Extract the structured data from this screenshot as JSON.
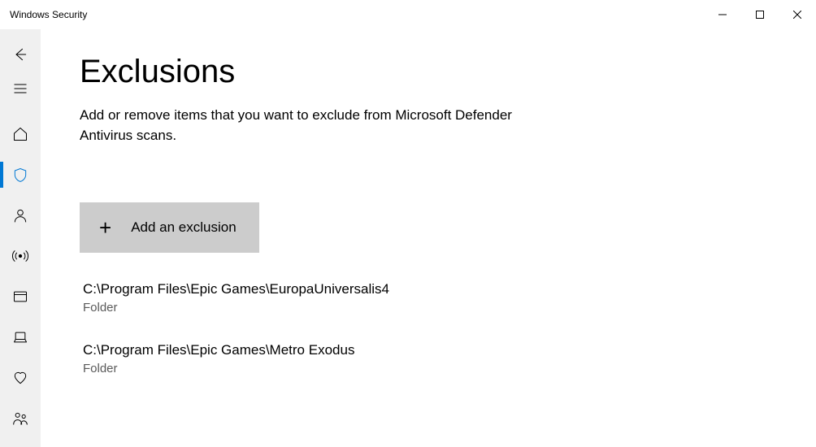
{
  "window": {
    "title": "Windows Security"
  },
  "page": {
    "heading": "Exclusions",
    "subtitle": "Add or remove items that you want to exclude from Microsoft Defender Antivirus scans.",
    "add_button_label": "Add an exclusion"
  },
  "exclusions": [
    {
      "path": "C:\\Program Files\\Epic Games\\EuropaUniversalis4",
      "type": "Folder"
    },
    {
      "path": "C:\\Program Files\\Epic Games\\Metro Exodus",
      "type": "Folder"
    }
  ],
  "sidebar": {
    "items": [
      {
        "id": "back",
        "icon": "back"
      },
      {
        "id": "menu",
        "icon": "hamburger"
      },
      {
        "id": "home",
        "icon": "home"
      },
      {
        "id": "virus",
        "icon": "shield",
        "selected": true
      },
      {
        "id": "account",
        "icon": "person"
      },
      {
        "id": "firewall",
        "icon": "broadcast"
      },
      {
        "id": "app-browser",
        "icon": "app-window"
      },
      {
        "id": "device-security",
        "icon": "chip"
      },
      {
        "id": "device-performance",
        "icon": "heart"
      },
      {
        "id": "family",
        "icon": "family"
      }
    ]
  }
}
